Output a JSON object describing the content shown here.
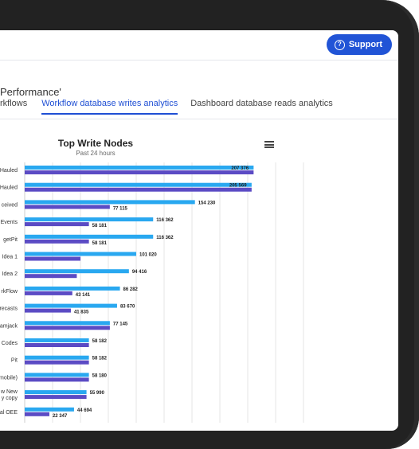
{
  "header": {
    "support_label": "Support",
    "support_icon": "question-circle-icon"
  },
  "page": {
    "title": "Performance'",
    "tabs": [
      {
        "label": "rkflows",
        "active": false
      },
      {
        "label": "Workflow database writes analytics",
        "active": true
      },
      {
        "label": "Dashboard database reads analytics",
        "active": false
      }
    ]
  },
  "colors": {
    "series_light": "#29a8f0",
    "series_dark": "#5b4bc4",
    "accent": "#2154d6"
  },
  "chart_data": {
    "type": "bar",
    "orientation": "horizontal",
    "title": "Top Write Nodes",
    "subtitle": "Past 24 hours",
    "categories": [
      "Hauled",
      "Hauled",
      "ceived",
      "Events",
      "getPit",
      "Idea 1",
      "Idea 2",
      "rkFlow",
      "recasts",
      "amjack",
      "Codes",
      "Pit",
      "mobile)",
      "w New\ny copy",
      "al OEE"
    ],
    "series": [
      {
        "values": [
          207376,
          205569,
          154230,
          116362,
          116362,
          101020,
          94416,
          86282,
          83670,
          77145,
          58182,
          58182,
          58180,
          55990,
          44694
        ]
      },
      {
        "values": [
          207376,
          205569,
          77115,
          58181,
          58181,
          50510,
          47208,
          43141,
          41835,
          77145,
          58182,
          58182,
          58180,
          55990,
          22347
        ]
      }
    ],
    "labels_light": [
      "207 376",
      "205 569",
      "154 230",
      "116 362",
      "116 362",
      "101 020",
      "94 416",
      "86 282",
      "83 670",
      "77 145",
      "58 182",
      "58 182",
      "58 180",
      "55 990",
      "44 694"
    ],
    "labels_dark": [
      "",
      "",
      "77 115",
      "58 181",
      "58 181",
      "",
      "",
      "43 141",
      "41 835",
      "",
      "",
      "",
      "",
      "",
      "22 347"
    ],
    "xlim": [
      0,
      210000
    ],
    "grid": true
  }
}
